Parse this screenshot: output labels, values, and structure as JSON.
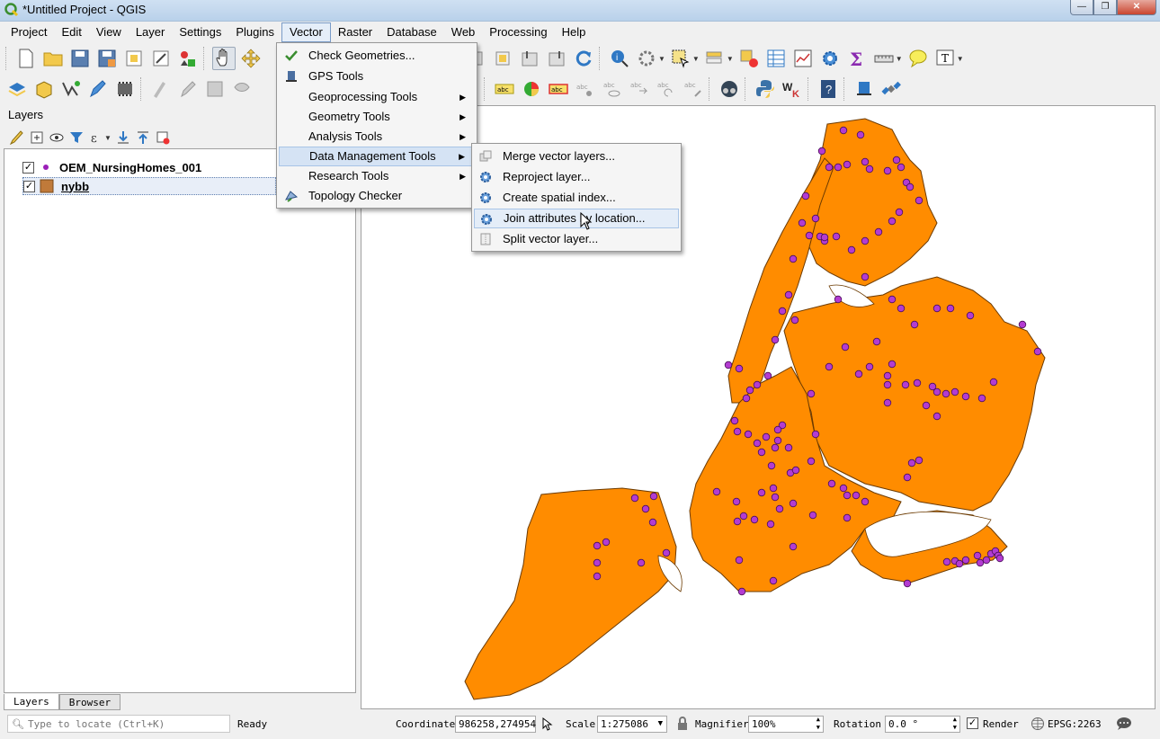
{
  "window": {
    "title": "*Untitled Project - QGIS",
    "buttons": [
      "—",
      "❐",
      "✕"
    ]
  },
  "menubar": [
    "Project",
    "Edit",
    "View",
    "Layer",
    "Settings",
    "Plugins",
    "Vector",
    "Raster",
    "Database",
    "Web",
    "Processing",
    "Help"
  ],
  "vector_menu": {
    "items": [
      {
        "label": "Check Geometries...",
        "icon": "check-geometries-icon"
      },
      {
        "label": "GPS Tools",
        "icon": "gps-icon"
      },
      {
        "label": "Geoprocessing Tools",
        "submenu": true
      },
      {
        "label": "Geometry Tools",
        "submenu": true
      },
      {
        "label": "Analysis Tools",
        "submenu": true
      },
      {
        "label": "Data Management Tools",
        "submenu": true
      },
      {
        "label": "Research Tools",
        "submenu": true
      },
      {
        "label": "Topology Checker",
        "icon": "topology-icon"
      }
    ]
  },
  "data_management_submenu": {
    "items": [
      {
        "label": "Merge vector layers...",
        "icon": "merge-icon"
      },
      {
        "label": "Reproject layer...",
        "icon": "gear-icon"
      },
      {
        "label": "Create spatial index...",
        "icon": "gear-icon"
      },
      {
        "label": "Join attributes by location...",
        "icon": "gear-icon"
      },
      {
        "label": "Split vector layer...",
        "icon": "split-icon"
      }
    ]
  },
  "layers_panel": {
    "title": "Layers",
    "layers": [
      {
        "name": "OEM_NursingHomes_001",
        "checked": true,
        "symbol_color": "#9b1fb8"
      },
      {
        "name": "nybb",
        "checked": true,
        "symbol_color": "#c07a3a"
      }
    ],
    "tabs": [
      "Layers",
      "Browser"
    ]
  },
  "map": {
    "fill_color": "#ff8c00",
    "point_color": "#b33cd1"
  },
  "statusbar": {
    "locate_placeholder": "Type to locate (Ctrl+K)",
    "ready": "Ready",
    "coordinate_label": "Coordinate",
    "coordinate_value": "986258,274954",
    "scale_label": "Scale",
    "scale_value": "1:275086",
    "magnifier_label": "Magnifier",
    "magnifier_value": "100%",
    "rotation_label": "Rotation",
    "rotation_value": "0.0 °",
    "render_label": "Render",
    "epsg": "EPSG:2263"
  }
}
